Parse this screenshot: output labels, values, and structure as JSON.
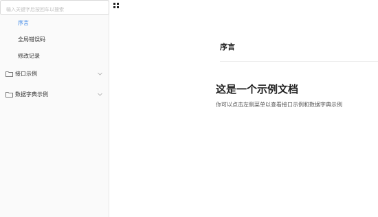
{
  "search": {
    "placeholder": "输入关键字后按回车以搜索",
    "value": ""
  },
  "sidebar": {
    "items": [
      {
        "label": "序言"
      },
      {
        "label": "全局错误码"
      },
      {
        "label": "修改记录"
      }
    ],
    "groups": [
      {
        "label": "接口示例",
        "icon": "folder-icon"
      },
      {
        "label": "数据字典示例",
        "icon": "folder-icon"
      }
    ]
  },
  "main": {
    "section_title": "序言",
    "heading": "这是一个示例文档",
    "description": "你可以点击左侧菜单以查看接口示例和数据字典示例"
  },
  "colors": {
    "active": "#2f7fe6"
  }
}
